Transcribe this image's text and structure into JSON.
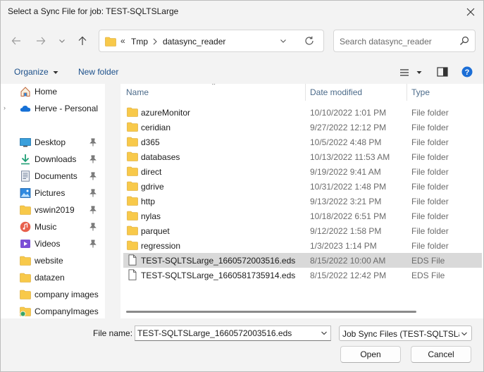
{
  "window": {
    "title": "Select a Sync File for job: TEST-SQLTSLarge"
  },
  "address": {
    "overflow": "«",
    "parts": [
      "Tmp",
      "datasync_reader"
    ]
  },
  "search": {
    "placeholder": "Search datasync_reader"
  },
  "toolbar": {
    "organize_label": "Organize",
    "new_folder_label": "New folder"
  },
  "sidebar": {
    "items": [
      {
        "label": "Home",
        "icon": "home-icon",
        "pinned": false
      },
      {
        "label": "Herve - Personal",
        "icon": "cloud-icon",
        "pinned": false
      },
      {
        "label": "Desktop",
        "icon": "desktop-icon",
        "pinned": true
      },
      {
        "label": "Downloads",
        "icon": "download-icon",
        "pinned": true
      },
      {
        "label": "Documents",
        "icon": "documents-icon",
        "pinned": true
      },
      {
        "label": "Pictures",
        "icon": "pictures-icon",
        "pinned": true
      },
      {
        "label": "vswin2019",
        "icon": "folder-icon",
        "pinned": true
      },
      {
        "label": "Music",
        "icon": "music-icon",
        "pinned": true
      },
      {
        "label": "Videos",
        "icon": "videos-icon",
        "pinned": true
      },
      {
        "label": "website",
        "icon": "folder-icon",
        "pinned": false
      },
      {
        "label": "datazen",
        "icon": "folder-icon",
        "pinned": false
      },
      {
        "label": "company images",
        "icon": "folder-icon",
        "pinned": false
      },
      {
        "label": "CompanyImages",
        "icon": "shared-folder-icon",
        "pinned": false
      }
    ]
  },
  "list": {
    "columns": {
      "name": "Name",
      "date": "Date modified",
      "type": "Type"
    },
    "rows": [
      {
        "name": "azureMonitor",
        "date": "10/10/2022 1:01 PM",
        "type": "File folder",
        "kind": "folder"
      },
      {
        "name": "ceridian",
        "date": "9/27/2022 12:12 PM",
        "type": "File folder",
        "kind": "folder"
      },
      {
        "name": "d365",
        "date": "10/5/2022 4:48 PM",
        "type": "File folder",
        "kind": "folder"
      },
      {
        "name": "databases",
        "date": "10/13/2022 11:53 AM",
        "type": "File folder",
        "kind": "folder"
      },
      {
        "name": "direct",
        "date": "9/19/2022 9:41 AM",
        "type": "File folder",
        "kind": "folder"
      },
      {
        "name": "gdrive",
        "date": "10/31/2022 1:48 PM",
        "type": "File folder",
        "kind": "folder"
      },
      {
        "name": "http",
        "date": "9/13/2022 3:21 PM",
        "type": "File folder",
        "kind": "folder"
      },
      {
        "name": "nylas",
        "date": "10/18/2022 6:51 PM",
        "type": "File folder",
        "kind": "folder"
      },
      {
        "name": "parquet",
        "date": "9/12/2022 1:58 PM",
        "type": "File folder",
        "kind": "folder"
      },
      {
        "name": "regression",
        "date": "1/3/2023 1:14 PM",
        "type": "File folder",
        "kind": "folder"
      },
      {
        "name": "TEST-SQLTSLarge_1660572003516.eds",
        "date": "8/15/2022 10:00 AM",
        "type": "EDS File",
        "kind": "file",
        "selected": true
      },
      {
        "name": "TEST-SQLTSLarge_1660581735914.eds",
        "date": "8/15/2022 12:42 PM",
        "type": "EDS File",
        "kind": "file"
      }
    ]
  },
  "footer": {
    "file_name_label": "File name:",
    "file_name_value": "TEST-SQLTSLarge_1660572003516.eds",
    "filter_value": "Job Sync Files (TEST-SQLTSLarg",
    "open_label": "Open",
    "cancel_label": "Cancel"
  },
  "colors": {
    "folder": "#f8c94a",
    "accent": "#1b6ed6",
    "selected_row": "#d9d9d9"
  }
}
